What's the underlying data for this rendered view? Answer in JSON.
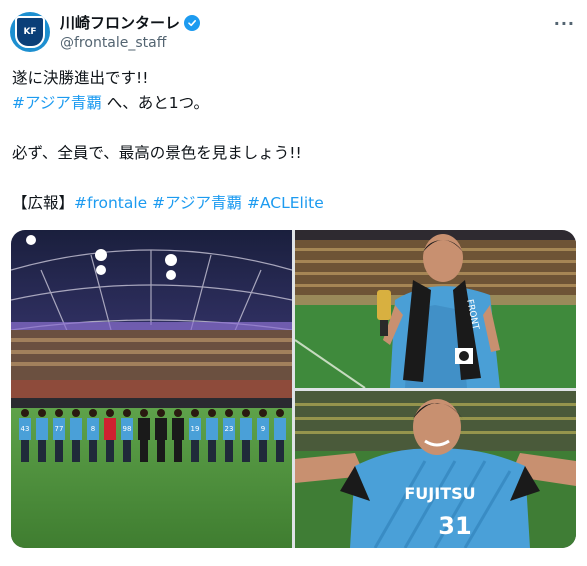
{
  "account": {
    "display_name": "川崎フロンターレ",
    "handle": "@frontale_staff",
    "avatar_label": "KF",
    "verified_icon": "verified-badge-icon",
    "brand_color": "#1d9bf0"
  },
  "tweet": {
    "line1": "遂に決勝進出です!!",
    "line2_tag": "#アジア青覇",
    "line2_rest": " へ、あと1つ。",
    "line3": "必ず、全員で、最高の景色を見ましょう!!",
    "line4_prefix": "【広報】",
    "tags": [
      "#frontale",
      "#アジア青覇",
      "#ACLElite"
    ]
  },
  "photos": {
    "photo1": {
      "numbers": [
        "43",
        "77",
        "8",
        "98",
        "16",
        "19",
        "23",
        "9"
      ]
    },
    "photo2": {
      "scarf_text": "FRONT"
    },
    "photo3": {
      "sponsor": "FUJITSU",
      "number": "31"
    }
  }
}
